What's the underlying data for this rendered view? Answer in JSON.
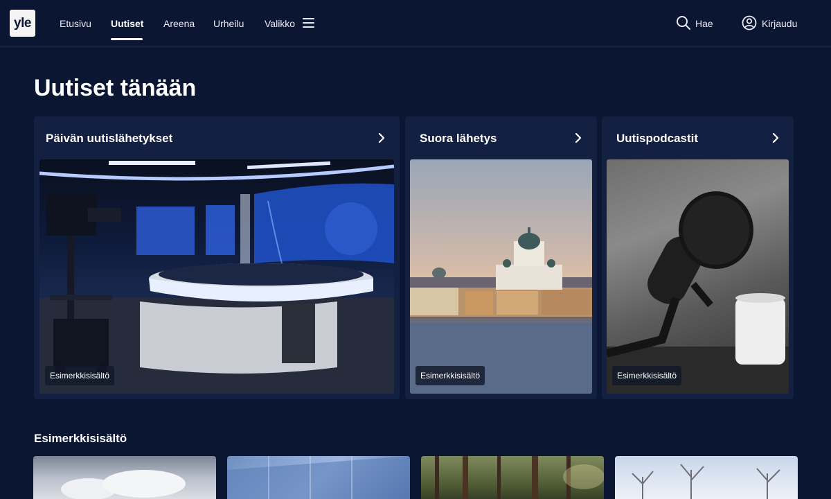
{
  "header": {
    "logo": "yle",
    "nav": [
      "Etusivu",
      "Uutiset",
      "Areena",
      "Urheilu",
      "Valikko"
    ],
    "search_label": "Hae",
    "login_label": "Kirjaudu"
  },
  "main": {
    "title": "Uutiset tänään",
    "cards": [
      {
        "title": "Päivän uutislähetykset",
        "badge": "Esimerkkisisältö"
      },
      {
        "title": "Suora lähetys",
        "badge": "Esimerkkisisältö"
      },
      {
        "title": "Uutispodcastit",
        "badge": "Esimerkkisisältö"
      }
    ],
    "section_title": "Esimerkkisisältö"
  },
  "colors": {
    "background": "#0b1632",
    "card": "#142042",
    "text": "#ffffff"
  },
  "icons": [
    "menu-icon",
    "search-icon",
    "user-icon",
    "chevron-right-icon"
  ]
}
